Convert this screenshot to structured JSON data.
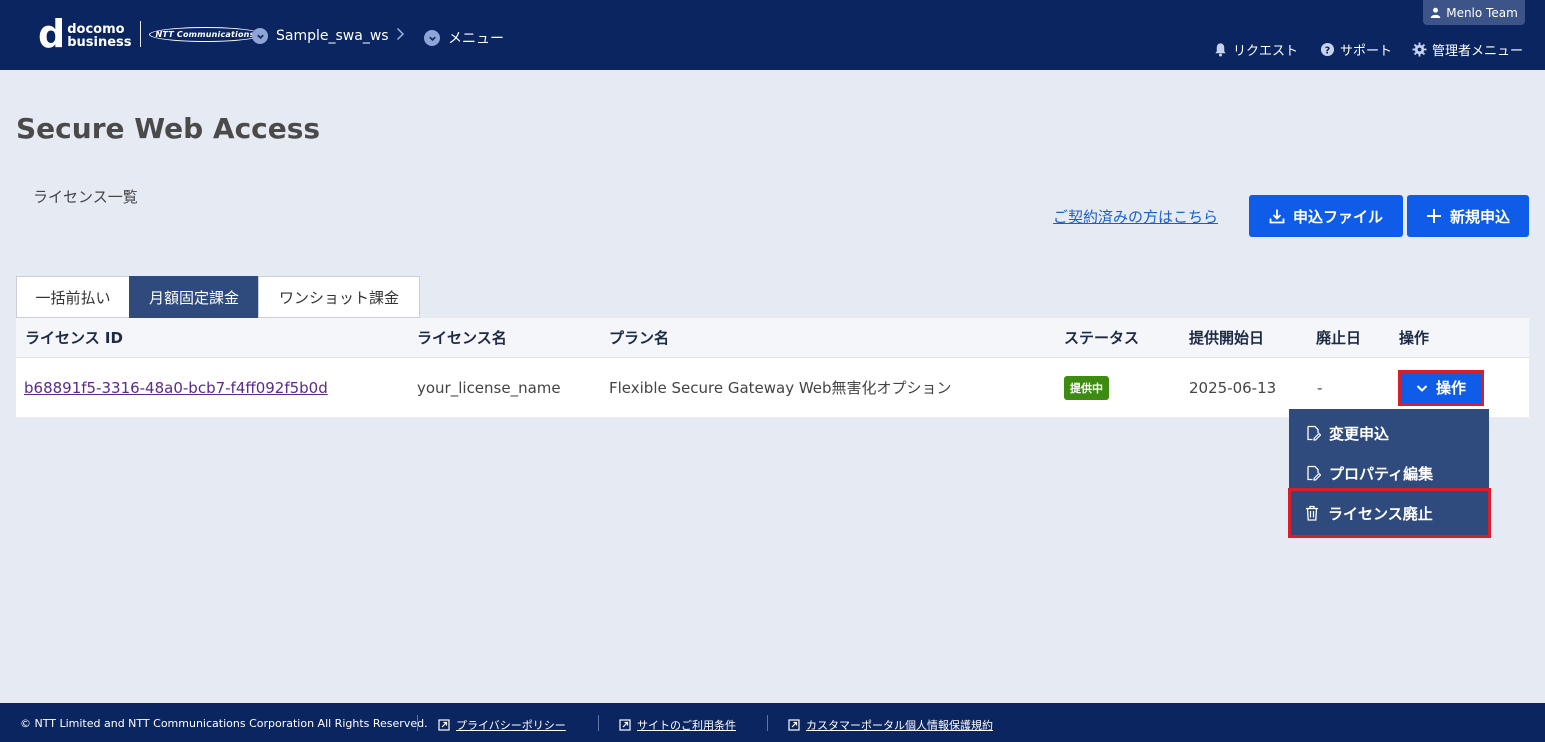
{
  "header": {
    "logo": {
      "letter": "d",
      "line1": "docomo",
      "line2": "business",
      "ntt": "NTT Communications"
    },
    "breadcrumbs": [
      {
        "label": "Sample_swa_ws",
        "icon": "chevron-down-icon"
      },
      {
        "label": "メニュー",
        "icon": "chevron-down-icon"
      }
    ],
    "user": "Menlo Team",
    "nav": [
      {
        "label": "リクエスト",
        "icon": "bell-icon"
      },
      {
        "label": "サポート",
        "icon": "help-icon"
      },
      {
        "label": "管理者メニュー",
        "icon": "gear-icon"
      }
    ]
  },
  "page": {
    "title": "Secure Web Access",
    "subtitle": "ライセンス一覧",
    "contract_link": "ご契約済みの方はこちら",
    "download_button": "申込ファイル",
    "new_button": "新規申込"
  },
  "tabs": [
    {
      "label": "一括前払い",
      "active": false
    },
    {
      "label": "月額固定課金",
      "active": true
    },
    {
      "label": "ワンショット課金",
      "active": false
    }
  ],
  "table": {
    "columns": [
      "ライセンス ID",
      "ライセンス名",
      "プラン名",
      "ステータス",
      "提供開始日",
      "廃止日",
      "操作"
    ],
    "rows": [
      {
        "license_id": "b68891f5-3316-48a0-bcb7-f4ff092f5b0d",
        "license_name": "your_license_name",
        "plan": "Flexible Secure Gateway Web無害化オプション",
        "status": "提供中",
        "start_date": "2025-06-13",
        "end_date": "-",
        "action": "操作"
      }
    ]
  },
  "dropdown": [
    {
      "label": "変更申込",
      "icon": "edit-doc-icon"
    },
    {
      "label": "プロパティ編集",
      "icon": "edit-doc-icon"
    },
    {
      "label": "ライセンス廃止",
      "icon": "trash-icon"
    }
  ],
  "colors": {
    "header_bg": "#0b2560",
    "primary": "#0e5ce8",
    "status_green": "#3d8c11",
    "highlight_red": "#d81e2a"
  },
  "footer": {
    "copyright": "© NTT Limited and NTT Communications Corporation All Rights Reserved.",
    "links": [
      "プライバシーポリシー",
      "サイトのご利用条件",
      "カスタマーポータル個人情報保護規約"
    ]
  }
}
